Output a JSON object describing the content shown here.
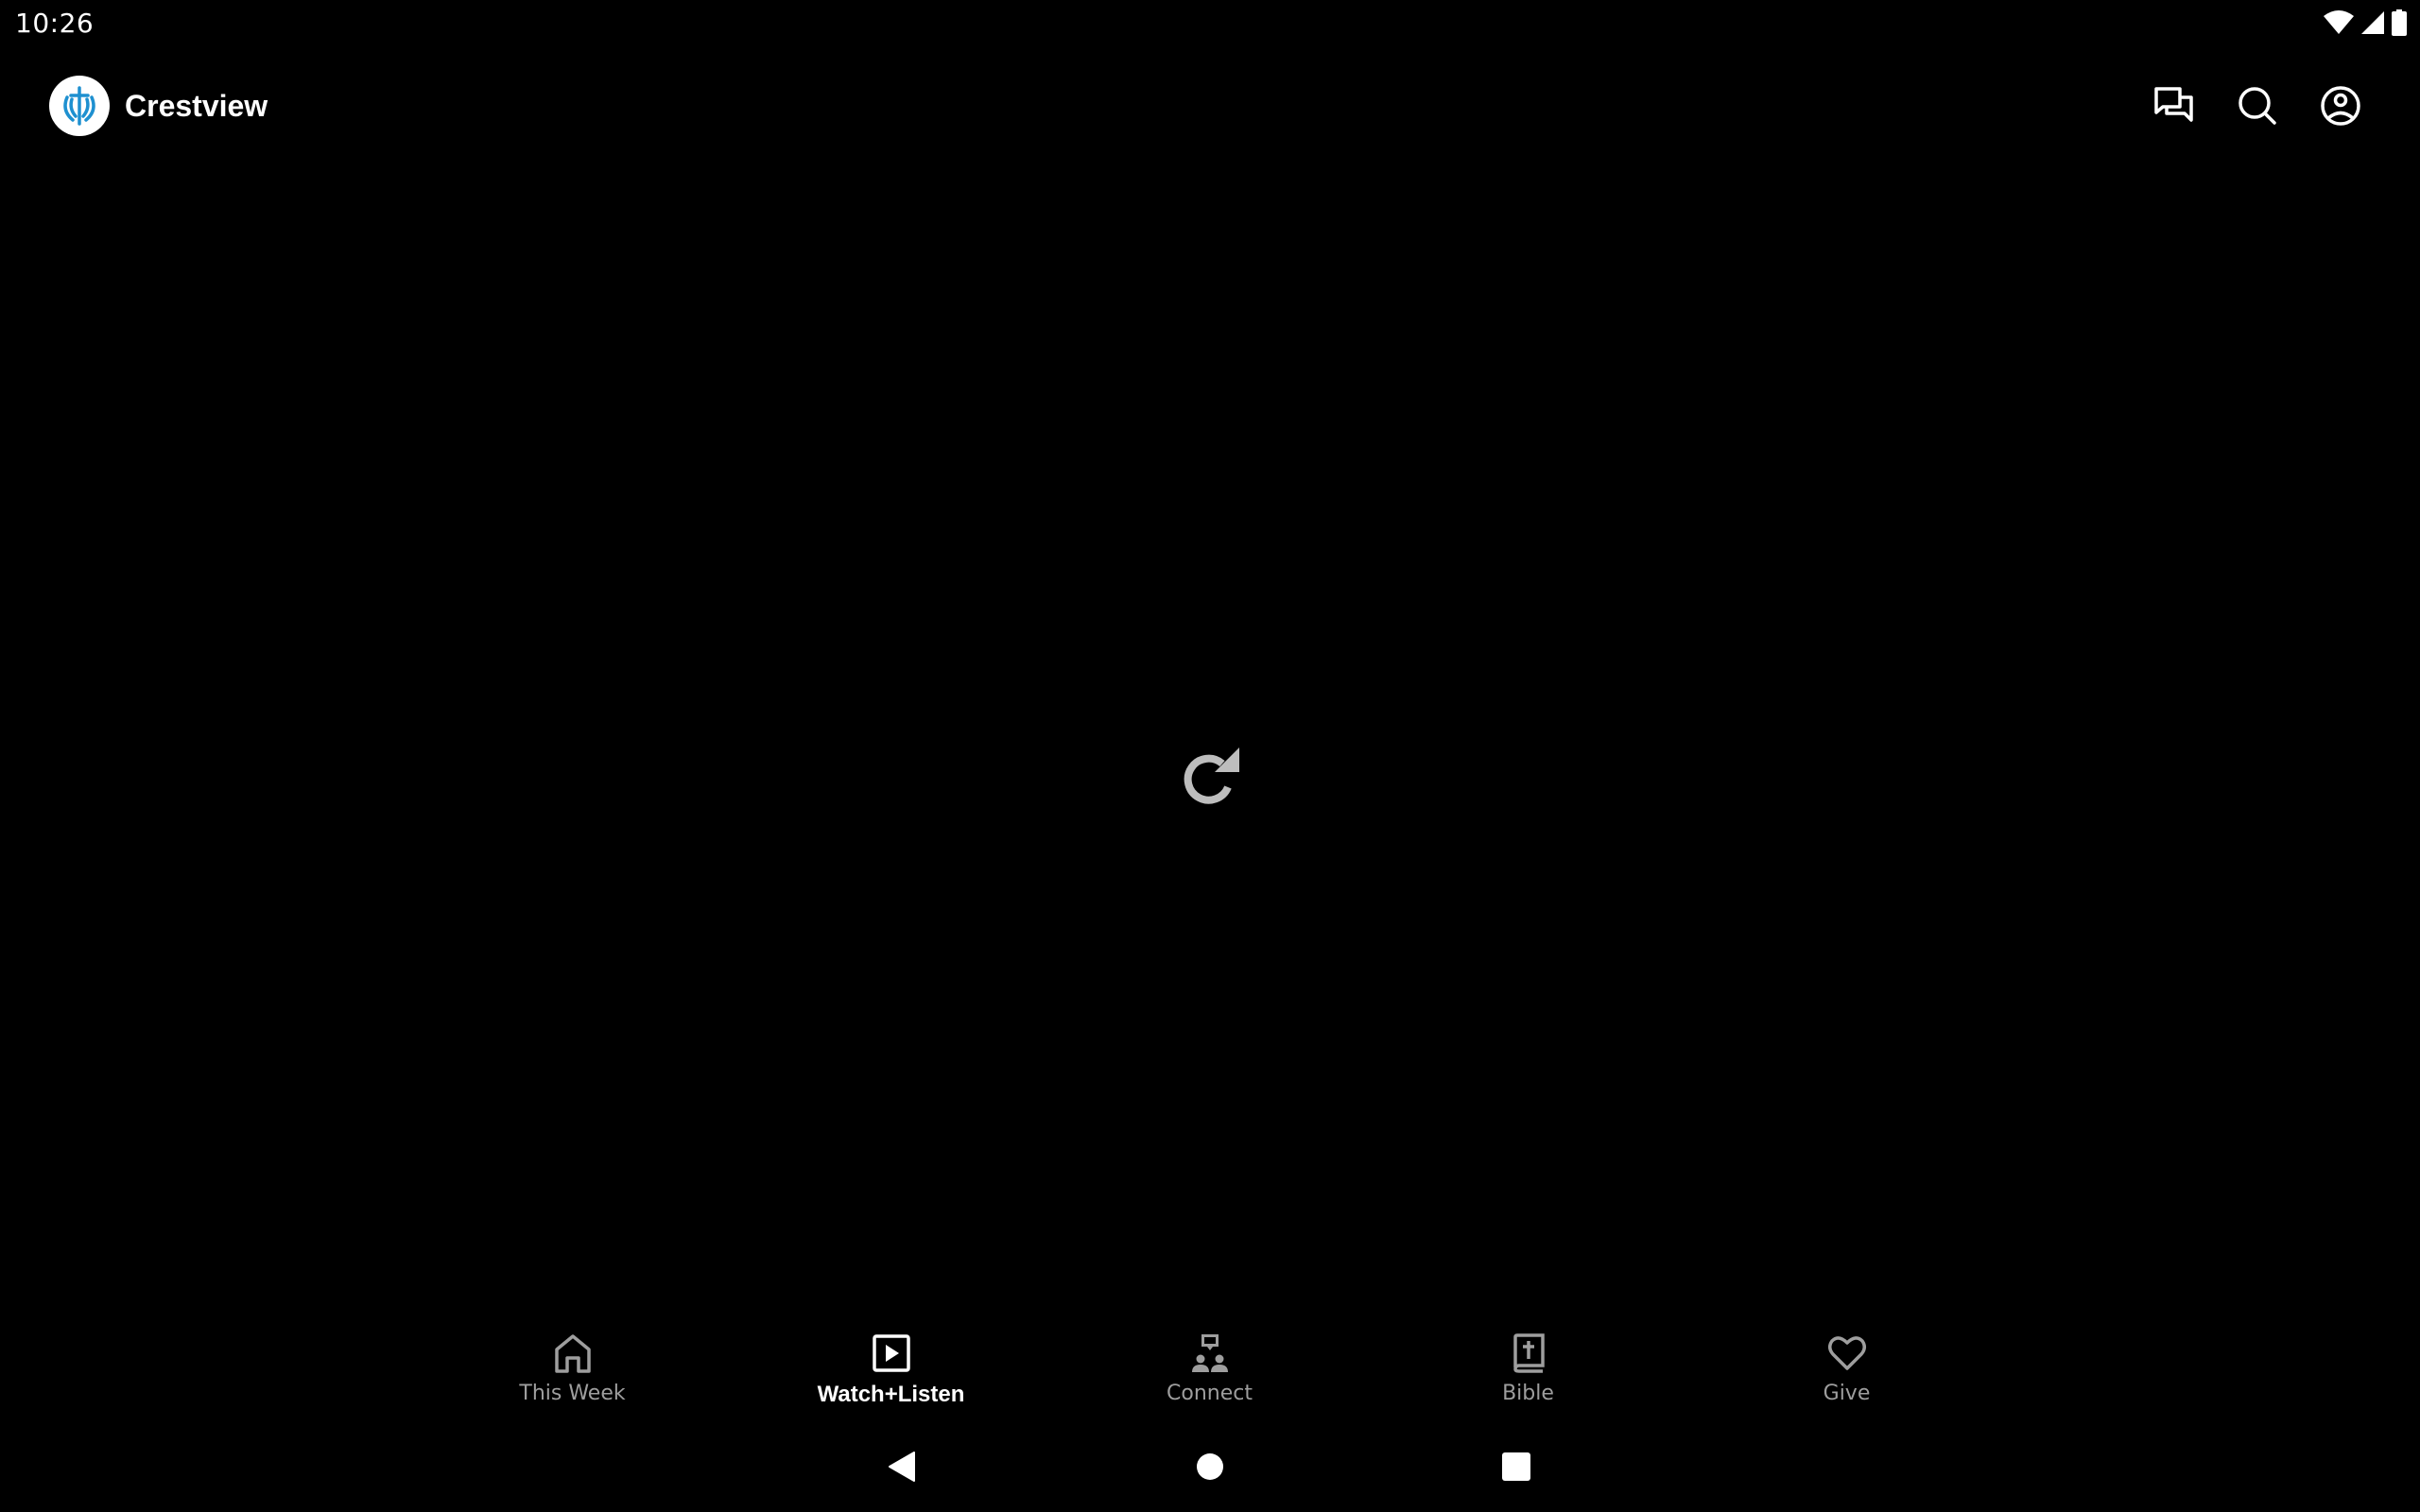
{
  "status_bar": {
    "time": "10:26",
    "icons": [
      "wifi-icon",
      "cellular-signal-icon",
      "battery-icon"
    ]
  },
  "app_bar": {
    "title": "Crestview",
    "logo": "crestview-logo",
    "actions": [
      {
        "name": "chat-icon",
        "label": "Messages"
      },
      {
        "name": "search-icon",
        "label": "Search"
      },
      {
        "name": "account-icon",
        "label": "Profile"
      }
    ]
  },
  "content": {
    "state": "refresh-icon",
    "icon_color": "#bdbdbd"
  },
  "bottom_nav": {
    "items": [
      {
        "label": "This Week",
        "icon": "home-icon",
        "active": false
      },
      {
        "label": "Watch+Listen",
        "icon": "play-box-icon",
        "active": true
      },
      {
        "label": "Connect",
        "icon": "connect-icon",
        "active": false
      },
      {
        "label": "Bible",
        "icon": "bible-icon",
        "active": false
      },
      {
        "label": "Give",
        "icon": "heart-icon",
        "active": false
      }
    ],
    "active_color": "#ffffff",
    "inactive_color": "#9e9e9e"
  },
  "system_nav": [
    "back-button",
    "home-button",
    "recents-button"
  ],
  "colors": {
    "background": "#000000",
    "brand": "#1e90d0"
  }
}
